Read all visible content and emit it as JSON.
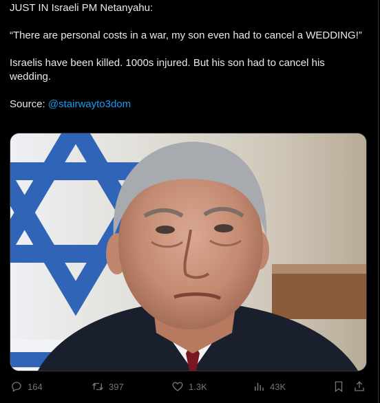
{
  "tweet": {
    "line1": "JUST IN Israeli PM Netanyahu:",
    "quote": "“There are personal costs in a war, my son even had to cancel a WEDDING!”",
    "body": "Israelis have been killed. 1000s injured. But his son had to cancel his wedding.",
    "source_label": "Source: ",
    "source_mention": "@stairwayto3dom"
  },
  "actions": {
    "replies": "164",
    "reposts": "397",
    "likes": "1.3K",
    "views": "43K"
  },
  "colors": {
    "background": "#000000",
    "text": "#e7e9ea",
    "muted": "#71767b",
    "link": "#1d9bf0",
    "border": "#2f3336"
  },
  "icons": [
    "reply-icon",
    "repost-icon",
    "like-icon",
    "views-icon",
    "bookmark-icon",
    "share-icon"
  ]
}
